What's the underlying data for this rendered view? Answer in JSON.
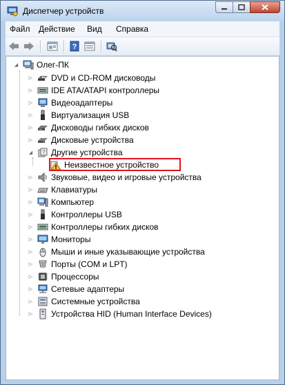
{
  "window": {
    "title": "Диспетчер устройств",
    "title_icon": "device-manager-icon"
  },
  "menu": {
    "file": "Файл",
    "action": "Действие",
    "view": "Вид",
    "help": "Справка"
  },
  "toolbar": {
    "buttons": [
      "back-arrow-icon",
      "forward-arrow-icon",
      "properties-icon",
      "help-icon",
      "view-icon",
      "scan-hardware-icon"
    ]
  },
  "tree": {
    "root": "Олег-ПК",
    "items": [
      {
        "label": "DVD и CD-ROM дисководы",
        "icon": "dvd-drive-icon"
      },
      {
        "label": "IDE ATA/ATAPI контроллеры",
        "icon": "ide-controller-icon"
      },
      {
        "label": "Видеоадаптеры",
        "icon": "display-adapter-icon"
      },
      {
        "label": "Виртуализация USB",
        "icon": "usb-icon"
      },
      {
        "label": "Дисководы гибких дисков",
        "icon": "floppy-drive-icon"
      },
      {
        "label": "Дисковые устройства",
        "icon": "disk-drive-icon"
      },
      {
        "label": "Другие устройства",
        "icon": "other-devices-icon"
      },
      {
        "label": "Неизвестное устройство",
        "icon": "unknown-device-warning-icon"
      },
      {
        "label": "Звуковые, видео и игровые устройства",
        "icon": "speaker-icon"
      },
      {
        "label": "Клавиатуры",
        "icon": "keyboard-icon"
      },
      {
        "label": "Компьютер",
        "icon": "computer-icon"
      },
      {
        "label": "Контроллеры USB",
        "icon": "usb-controller-icon"
      },
      {
        "label": "Контроллеры гибких дисков",
        "icon": "floppy-controller-icon"
      },
      {
        "label": "Мониторы",
        "icon": "monitor-icon"
      },
      {
        "label": "Мыши и иные указывающие устройства",
        "icon": "mouse-icon"
      },
      {
        "label": "Порты (COM и LPT)",
        "icon": "port-icon"
      },
      {
        "label": "Процессоры",
        "icon": "processor-icon"
      },
      {
        "label": "Сетевые адаптеры",
        "icon": "network-adapter-icon"
      },
      {
        "label": "Системные устройства",
        "icon": "system-devices-icon"
      },
      {
        "label": "Устройства HID (Human Interface Devices)",
        "icon": "hid-device-icon"
      }
    ]
  },
  "colors": {
    "highlight": "#e2141b",
    "title_gradient_top": "#dbe9f8"
  }
}
